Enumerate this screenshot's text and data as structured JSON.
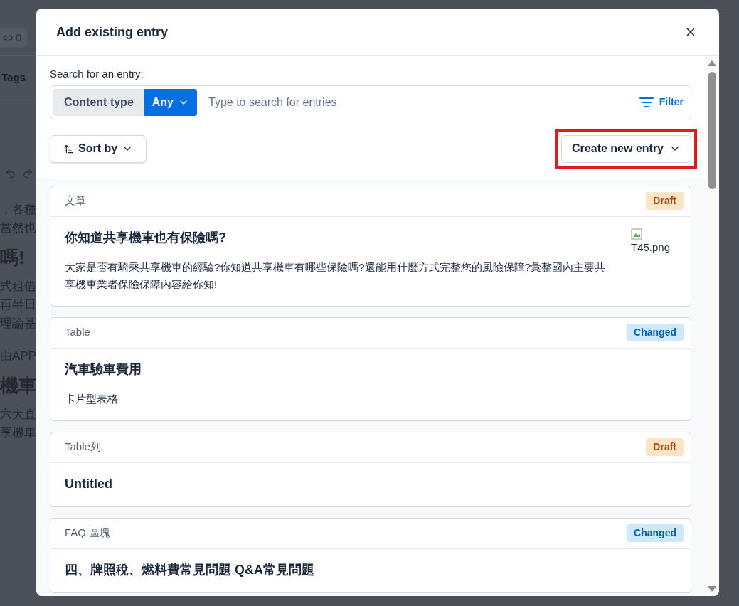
{
  "background_page": {
    "link_count": "0",
    "tags_label": "Tags",
    "text_lines": [
      {
        "kind": "paragraph",
        "text": "，各種"
      },
      {
        "kind": "paragraph",
        "text": "當然也"
      },
      {
        "kind": "heading",
        "text": "嗎!"
      },
      {
        "kind": "paragraph",
        "text": "式租借"
      },
      {
        "kind": "paragraph",
        "text": "再半日"
      },
      {
        "kind": "paragraph",
        "text": "理論基"
      },
      {
        "kind": "gap"
      },
      {
        "kind": "paragraph",
        "text": "由APP"
      },
      {
        "kind": "heading",
        "text": "機車"
      },
      {
        "kind": "paragraph",
        "text": "六大直"
      },
      {
        "kind": "paragraph",
        "text": "享機車"
      }
    ]
  },
  "dialog": {
    "title": "Add existing entry",
    "search": {
      "label": "Search for an entry:",
      "content_type_label": "Content type",
      "content_type_value": "Any",
      "placeholder": "Type to search for entries",
      "filter_label": "Filter"
    },
    "sort_label": "Sort by",
    "create_button": {
      "label": "Create new entry",
      "highlighted": true
    },
    "entries": [
      {
        "content_type": "文章",
        "status": {
          "kind": "draft",
          "label": "Draft"
        },
        "title": "你知道共享機車也有保險嗎?",
        "description": "大家是否有騎乘共享機車的經驗?你知道共享機車有哪些保險嗎?還能用什麼方式完整您的風險保障?彙整國內主要共享機車業者保險保障內容給你知!",
        "image_alt": "T45.png"
      },
      {
        "content_type": "Table",
        "status": {
          "kind": "changed",
          "label": "Changed"
        },
        "title": "汽車驗車費用",
        "description": "卡片型表格"
      },
      {
        "content_type": "Table列",
        "status": {
          "kind": "draft",
          "label": "Draft"
        },
        "title": "Untitled"
      },
      {
        "content_type": "FAQ 區塊",
        "status": {
          "kind": "changed",
          "label": "Changed"
        },
        "title": "四、牌照稅、燃料費常見問題 Q&A常見問題"
      }
    ]
  }
}
